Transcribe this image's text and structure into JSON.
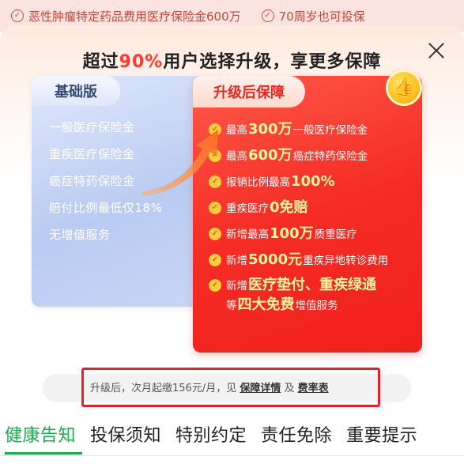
{
  "background_strip": {
    "items": [
      {
        "icon": "check-circle-icon",
        "label": "恶性肿瘤特定药品费用医疗保险金600万"
      },
      {
        "icon": "check-circle-icon",
        "label": "70周岁也可投保"
      }
    ]
  },
  "modal": {
    "title_prefix": "超过",
    "title_highlight": "90%",
    "title_suffix": "用户选择升级，享更多保障",
    "close_icon": "close-icon"
  },
  "basic_plan": {
    "tag": "基础版",
    "items": [
      "一般医疗保险金",
      "重疾医疗保险金",
      "癌症特药保险金",
      "赔付比例最低仅18%",
      "无增值服务"
    ]
  },
  "upgrade_plan": {
    "tag": "升级后保障",
    "badge_icon": "thumbs-up-icon",
    "items": [
      {
        "pre": "最高",
        "big": "300万",
        "post": "一般医疗保险金"
      },
      {
        "pre": "最高",
        "big": "600万",
        "post": "癌症特药保险金"
      },
      {
        "pre": "报销比例最高",
        "big": "100%",
        "post": ""
      },
      {
        "pre": "重疾医疗",
        "big": "0免赔",
        "post": ""
      },
      {
        "pre": "新增最高",
        "big": "100万",
        "post": "质重医疗"
      },
      {
        "pre": "新增",
        "big": "5000元",
        "post": "重疾异地转诊费用"
      },
      {
        "pre": "新增",
        "big": "医疗垫付、重疾绿通",
        "line2_pre": "等",
        "line2_big": "四大免费",
        "line2_post": "增值服务"
      }
    ]
  },
  "notice": {
    "text": "升级后，次月起缴156元/月，见",
    "link1": "保障详情",
    "mid": "及",
    "link2": "费率表"
  },
  "tabs": [
    {
      "label": "健康告知",
      "active": true
    },
    {
      "label": "投保须知",
      "active": false
    },
    {
      "label": "特别约定",
      "active": false
    },
    {
      "label": "责任免除",
      "active": false
    },
    {
      "label": "重要提示",
      "active": false
    }
  ],
  "colors": {
    "accent_red": "#f52c25",
    "highlight_yellow": "#fff4a0",
    "tab_active_green": "#1aab4f",
    "basic_blue": "#b9cbf2"
  }
}
